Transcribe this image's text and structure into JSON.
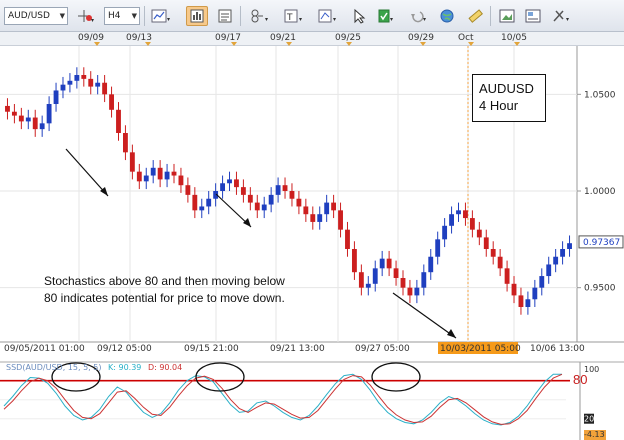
{
  "toolbar": {
    "symbol": "AUD/USD",
    "timeframe": "H4",
    "icons": [
      "symbol-menu-icon",
      "crosshair-icon",
      "timeframe-menu-icon",
      "chart-type-icon",
      "indicators-icon",
      "studies-icon",
      "draw-tools-icon",
      "text-tool-icon",
      "zoom-tool-icon",
      "cursor-icon",
      "flag-icon",
      "undo-icon",
      "globe-icon",
      "ruler-icon",
      "screenshot-icon",
      "settings-icon"
    ]
  },
  "top_dates": [
    "09/09",
    "09/13",
    "09/17",
    "09/21",
    "09/25",
    "09/29",
    "Oct",
    "10/05"
  ],
  "bottom_dates": [
    "09/05/2011 01:00",
    "09/12 05:00",
    "09/15 21:00",
    "09/21 13:00",
    "09/27 05:00",
    "10/03/2011 05:00",
    "10/06 13:00"
  ],
  "price_axis": [
    "1.0500",
    "1.0000",
    "0.9500"
  ],
  "current_price": "0.97367",
  "annotation_box": {
    "line1": "AUDUSD",
    "line2": "4 Hour"
  },
  "note": {
    "line1": "Stochastics above 80 and then moving below",
    "line2": "80 indicates potential for price to move down."
  },
  "indicator": {
    "title": "SSD(AUD/USD, 15, 5, 5)",
    "k_label": "K: 90.39",
    "d_label": "D: 90.04",
    "level_tag": "80",
    "axis_top": "100",
    "axis_mid": "20",
    "axis_bottom": "-4.13"
  },
  "colors": {
    "up": "#1f3fbf",
    "down": "#cc1f1f",
    "k_line": "#2ab0c8",
    "d_line": "#cc3333",
    "level": "#cc0000",
    "highlight": "#f59a1a"
  },
  "chart_data": [
    {
      "type": "candlestick",
      "title": "AUDUSD 4 Hour",
      "x_range": [
        "09/05/2011 01:00",
        "10/06 13:00"
      ],
      "ylim": [
        0.925,
        1.075
      ],
      "series": [
        {
          "values": [
            1.041,
            1.039,
            1.036,
            1.038,
            1.032,
            1.035,
            1.045,
            1.052,
            1.055,
            1.057,
            1.06,
            1.058,
            1.054,
            1.056,
            1.05,
            1.042,
            1.03,
            1.02,
            1.01,
            1.005,
            1.008,
            1.012,
            1.006,
            1.01,
            1.008,
            1.003,
            0.998,
            0.99,
            0.992,
            0.996,
            1.0,
            1.004,
            1.006,
            1.002,
            0.998,
            0.994,
            0.99,
            0.993,
            0.998,
            1.003,
            1.0,
            0.996,
            0.992,
            0.988,
            0.984,
            0.988,
            0.994,
            0.99,
            0.98,
            0.97,
            0.958,
            0.95,
            0.952,
            0.96,
            0.965,
            0.96,
            0.955,
            0.95,
            0.946,
            0.95,
            0.958,
            0.966,
            0.975,
            0.982,
            0.988,
            0.99,
            0.986,
            0.98,
            0.976,
            0.97,
            0.966,
            0.96,
            0.952,
            0.946,
            0.94,
            0.944,
            0.95,
            0.956,
            0.962,
            0.966,
            0.97,
            0.973
          ]
        }
      ]
    },
    {
      "type": "line",
      "title": "SSD(AUD/USD, 15, 5, 5)",
      "ylim": [
        -4.13,
        100
      ],
      "reference_line": 80,
      "series": [
        {
          "name": "K",
          "values": [
            40,
            55,
            72,
            85,
            84,
            76,
            60,
            40,
            25,
            18,
            22,
            35,
            55,
            70,
            62,
            45,
            30,
            22,
            28,
            45,
            65,
            80,
            88,
            86,
            78,
            60,
            42,
            30,
            32,
            45,
            48,
            40,
            30,
            22,
            18,
            25,
            40,
            58,
            75,
            88,
            90,
            82,
            65,
            45,
            30,
            20,
            14,
            12,
            18,
            30,
            45,
            55,
            50,
            40,
            28,
            18,
            12,
            10,
            14,
            24,
            40,
            60,
            78,
            90,
            90
          ]
        },
        {
          "name": "D",
          "values": [
            35,
            48,
            64,
            78,
            84,
            80,
            68,
            50,
            33,
            22,
            20,
            28,
            45,
            62,
            64,
            52,
            38,
            27,
            25,
            38,
            56,
            72,
            84,
            87,
            82,
            68,
            50,
            36,
            30,
            38,
            45,
            43,
            35,
            27,
            21,
            22,
            33,
            50,
            67,
            82,
            88,
            86,
            73,
            55,
            38,
            26,
            18,
            14,
            15,
            24,
            38,
            50,
            52,
            45,
            34,
            23,
            15,
            11,
            12,
            20,
            33,
            52,
            70,
            84,
            90
          ]
        }
      ]
    }
  ]
}
